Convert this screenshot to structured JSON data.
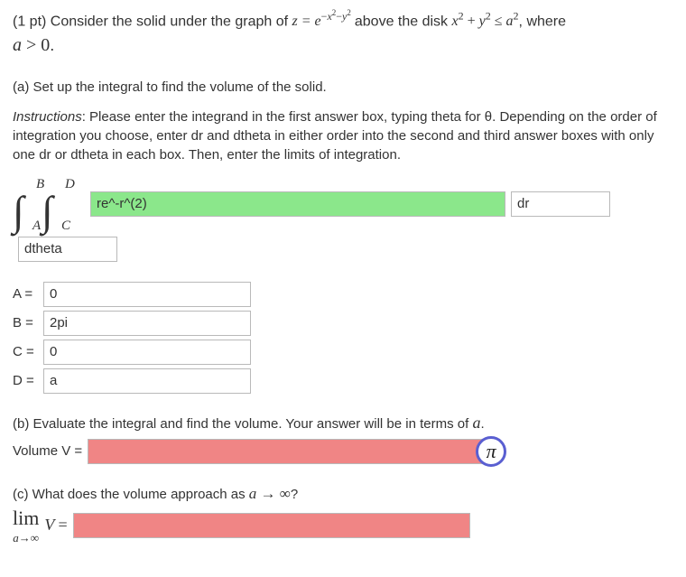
{
  "prompt": {
    "points": "(1 pt)",
    "lead": "Consider the solid under the graph of",
    "eq_main_html": "z = e<sup>&minus;x<sup>2</sup>&minus;y<sup>2</sup></sup>",
    "mid": "above the disk",
    "eq_disk_html": "x<sup>2</sup> + y<sup>2</sup> &le; a<sup>2</sup>",
    "tail": ", where",
    "cond_html": "a &gt; 0",
    "period": "."
  },
  "part_a": {
    "label": "(a) Set up the integral to find the volume of the solid.",
    "instructions_lead": "Instructions",
    "instructions_body": ": Please enter the integrand in the first answer box, typing theta for θ. Depending on the order of integration you choose, enter dr and dtheta in either order into the second and third answer boxes with only one dr or dtheta in each box. Then, enter the limits of integration.",
    "int_bounds": {
      "A": "A",
      "B": "B",
      "C": "C",
      "D": "D"
    },
    "integrand": "re^-r^(2)",
    "d1": "dr",
    "d2": "dtheta",
    "bounds": {
      "A_label": "A =",
      "A": "0",
      "B_label": "B =",
      "B": "2pi",
      "C_label": "C =",
      "C": "0",
      "D_label": "D =",
      "D": "a"
    }
  },
  "part_b": {
    "text": "(b) Evaluate the integral and find the volume. Your answer will be in terms of ",
    "var": "a",
    "tail": ".",
    "vol_label": "Volume V =",
    "vol_value": "",
    "pi": "π"
  },
  "part_c": {
    "text": "(c) What does the volume approach as ",
    "limit_inline_html": "a &rarr; &infin;",
    "q": "?",
    "lim_word": "lim",
    "lim_sub_html": "a&rarr;&infin;",
    "V_eq": "V =",
    "value": ""
  }
}
